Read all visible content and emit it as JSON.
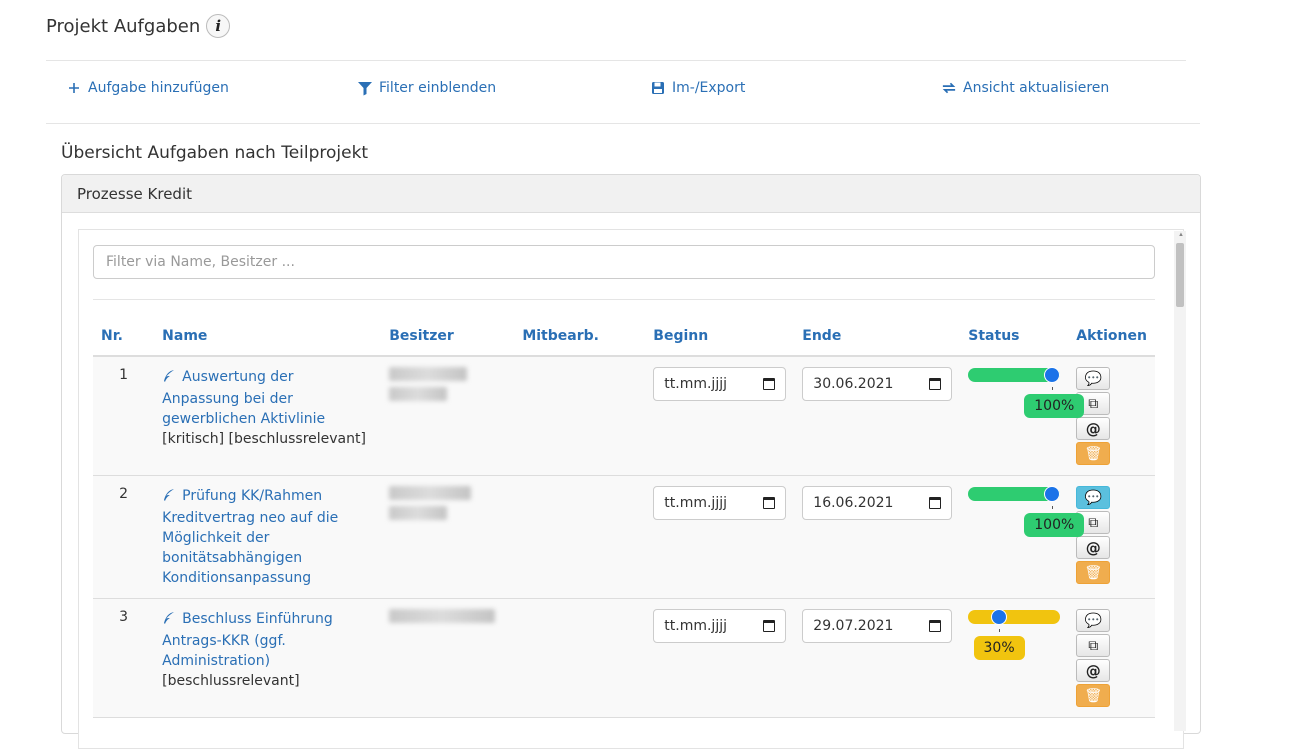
{
  "page": {
    "title": "Projekt Aufgaben",
    "info_icon": "info-icon"
  },
  "toolbar": {
    "add": {
      "label": "Aufgabe hinzufügen",
      "icon": "plus-icon"
    },
    "filter": {
      "label": "Filter einblenden",
      "icon": "filter-icon"
    },
    "export": {
      "label": "Im-/Export",
      "icon": "floppy-disk-icon"
    },
    "refresh": {
      "label": "Ansicht aktualisieren",
      "icon": "refresh-arrows-icon"
    }
  },
  "section": {
    "title": "Übersicht Aufgaben nach Teilprojekt"
  },
  "panel": {
    "title": "Prozesse Kredit",
    "filter_placeholder": "Filter via Name, Besitzer ...",
    "columns": [
      "Nr.",
      "Name",
      "Besitzer",
      "Mitbearb.",
      "Beginn",
      "Ende",
      "Status",
      "Aktionen"
    ],
    "rows": [
      {
        "nr": "1",
        "name": "Auswertung der Anpassung bei der gewerblichen Aktivlinie",
        "tags": "[kritisch] [beschlussrelevant]",
        "begin": "tt.mm.jjjj",
        "end": "30.06.2021",
        "status_label": "100%",
        "status_value": 100,
        "status_color": "#2ecc71"
      },
      {
        "nr": "2",
        "name": "Prüfung KK/Rahmen Kreditvertrag neo auf die Möglichkeit der bonitätsabhängigen Konditionsanpassung",
        "tags": "",
        "begin": "tt.mm.jjjj",
        "end": "16.06.2021",
        "status_label": "100%",
        "status_value": 100,
        "status_color": "#2ecc71"
      },
      {
        "nr": "3",
        "name": "Beschluss Einführung Antrags-KKR (ggf. Administration)",
        "tags": "[beschlussrelevant]",
        "begin": "tt.mm.jjjj",
        "end": "29.07.2021",
        "status_label": "30%",
        "status_value": 30,
        "status_color": "#f1c40f"
      }
    ]
  },
  "colors": {
    "link": "#2a6fb5",
    "success": "#2ecc71",
    "warning": "#f1c40f",
    "delete": "#f0ad4e",
    "active_comment": "#5bc0de"
  }
}
